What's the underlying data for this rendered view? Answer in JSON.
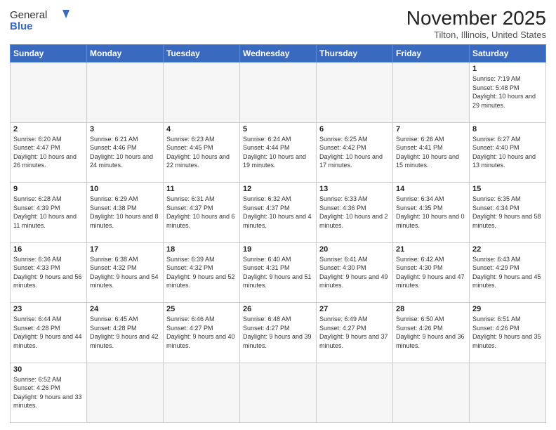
{
  "header": {
    "logo_general": "General",
    "logo_blue": "Blue",
    "month_title": "November 2025",
    "location": "Tilton, Illinois, United States"
  },
  "weekdays": [
    "Sunday",
    "Monday",
    "Tuesday",
    "Wednesday",
    "Thursday",
    "Friday",
    "Saturday"
  ],
  "weeks": [
    [
      {
        "day": "",
        "info": ""
      },
      {
        "day": "",
        "info": ""
      },
      {
        "day": "",
        "info": ""
      },
      {
        "day": "",
        "info": ""
      },
      {
        "day": "",
        "info": ""
      },
      {
        "day": "",
        "info": ""
      },
      {
        "day": "1",
        "info": "Sunrise: 7:19 AM\nSunset: 5:48 PM\nDaylight: 10 hours\nand 29 minutes."
      }
    ],
    [
      {
        "day": "2",
        "info": "Sunrise: 6:20 AM\nSunset: 4:47 PM\nDaylight: 10 hours\nand 26 minutes."
      },
      {
        "day": "3",
        "info": "Sunrise: 6:21 AM\nSunset: 4:46 PM\nDaylight: 10 hours\nand 24 minutes."
      },
      {
        "day": "4",
        "info": "Sunrise: 6:23 AM\nSunset: 4:45 PM\nDaylight: 10 hours\nand 22 minutes."
      },
      {
        "day": "5",
        "info": "Sunrise: 6:24 AM\nSunset: 4:44 PM\nDaylight: 10 hours\nand 19 minutes."
      },
      {
        "day": "6",
        "info": "Sunrise: 6:25 AM\nSunset: 4:42 PM\nDaylight: 10 hours\nand 17 minutes."
      },
      {
        "day": "7",
        "info": "Sunrise: 6:26 AM\nSunset: 4:41 PM\nDaylight: 10 hours\nand 15 minutes."
      },
      {
        "day": "8",
        "info": "Sunrise: 6:27 AM\nSunset: 4:40 PM\nDaylight: 10 hours\nand 13 minutes."
      }
    ],
    [
      {
        "day": "9",
        "info": "Sunrise: 6:28 AM\nSunset: 4:39 PM\nDaylight: 10 hours\nand 11 minutes."
      },
      {
        "day": "10",
        "info": "Sunrise: 6:29 AM\nSunset: 4:38 PM\nDaylight: 10 hours\nand 8 minutes."
      },
      {
        "day": "11",
        "info": "Sunrise: 6:31 AM\nSunset: 4:37 PM\nDaylight: 10 hours\nand 6 minutes."
      },
      {
        "day": "12",
        "info": "Sunrise: 6:32 AM\nSunset: 4:37 PM\nDaylight: 10 hours\nand 4 minutes."
      },
      {
        "day": "13",
        "info": "Sunrise: 6:33 AM\nSunset: 4:36 PM\nDaylight: 10 hours\nand 2 minutes."
      },
      {
        "day": "14",
        "info": "Sunrise: 6:34 AM\nSunset: 4:35 PM\nDaylight: 10 hours\nand 0 minutes."
      },
      {
        "day": "15",
        "info": "Sunrise: 6:35 AM\nSunset: 4:34 PM\nDaylight: 9 hours\nand 58 minutes."
      }
    ],
    [
      {
        "day": "16",
        "info": "Sunrise: 6:36 AM\nSunset: 4:33 PM\nDaylight: 9 hours\nand 56 minutes."
      },
      {
        "day": "17",
        "info": "Sunrise: 6:38 AM\nSunset: 4:32 PM\nDaylight: 9 hours\nand 54 minutes."
      },
      {
        "day": "18",
        "info": "Sunrise: 6:39 AM\nSunset: 4:32 PM\nDaylight: 9 hours\nand 52 minutes."
      },
      {
        "day": "19",
        "info": "Sunrise: 6:40 AM\nSunset: 4:31 PM\nDaylight: 9 hours\nand 51 minutes."
      },
      {
        "day": "20",
        "info": "Sunrise: 6:41 AM\nSunset: 4:30 PM\nDaylight: 9 hours\nand 49 minutes."
      },
      {
        "day": "21",
        "info": "Sunrise: 6:42 AM\nSunset: 4:30 PM\nDaylight: 9 hours\nand 47 minutes."
      },
      {
        "day": "22",
        "info": "Sunrise: 6:43 AM\nSunset: 4:29 PM\nDaylight: 9 hours\nand 45 minutes."
      }
    ],
    [
      {
        "day": "23",
        "info": "Sunrise: 6:44 AM\nSunset: 4:28 PM\nDaylight: 9 hours\nand 44 minutes."
      },
      {
        "day": "24",
        "info": "Sunrise: 6:45 AM\nSunset: 4:28 PM\nDaylight: 9 hours\nand 42 minutes."
      },
      {
        "day": "25",
        "info": "Sunrise: 6:46 AM\nSunset: 4:27 PM\nDaylight: 9 hours\nand 40 minutes."
      },
      {
        "day": "26",
        "info": "Sunrise: 6:48 AM\nSunset: 4:27 PM\nDaylight: 9 hours\nand 39 minutes."
      },
      {
        "day": "27",
        "info": "Sunrise: 6:49 AM\nSunset: 4:27 PM\nDaylight: 9 hours\nand 37 minutes."
      },
      {
        "day": "28",
        "info": "Sunrise: 6:50 AM\nSunset: 4:26 PM\nDaylight: 9 hours\nand 36 minutes."
      },
      {
        "day": "29",
        "info": "Sunrise: 6:51 AM\nSunset: 4:26 PM\nDaylight: 9 hours\nand 35 minutes."
      }
    ],
    [
      {
        "day": "30",
        "info": "Sunrise: 6:52 AM\nSunset: 4:26 PM\nDaylight: 9 hours\nand 33 minutes."
      },
      {
        "day": "",
        "info": ""
      },
      {
        "day": "",
        "info": ""
      },
      {
        "day": "",
        "info": ""
      },
      {
        "day": "",
        "info": ""
      },
      {
        "day": "",
        "info": ""
      },
      {
        "day": "",
        "info": ""
      }
    ]
  ]
}
